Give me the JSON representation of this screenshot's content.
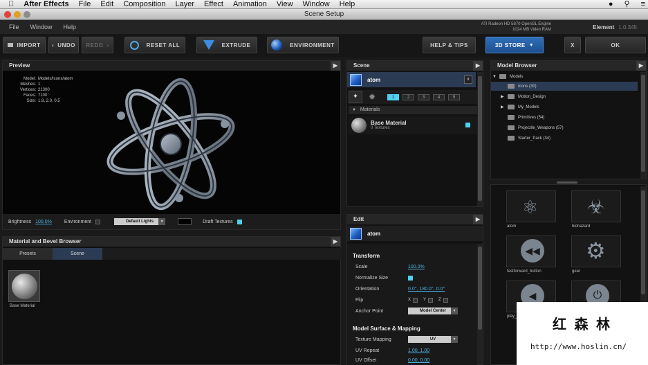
{
  "mac_menu": {
    "app": "After Effects",
    "items": [
      "File",
      "Edit",
      "Composition",
      "Layer",
      "Effect",
      "Animation",
      "View",
      "Window",
      "Help"
    ]
  },
  "window": {
    "title": "Scene Setup"
  },
  "plugin_menu": [
    "File",
    "Window",
    "Help"
  ],
  "gpu_info": {
    "line1": "ATI Radeon HD 5870 OpenGL Engine",
    "line2": "1024 MB Video RAM"
  },
  "version": {
    "label": "Element",
    "number": "1.0.345"
  },
  "toolbar": {
    "import": "IMPORT",
    "undo": "UNDO",
    "redo": "REDO",
    "reset_all": "RESET ALL",
    "extrude": "EXTRUDE",
    "environment": "ENVIRONMENT",
    "help_tips": "HELP & TIPS",
    "store": "3D STORE",
    "close": "X",
    "ok": "OK"
  },
  "preview": {
    "title": "Preview",
    "info": [
      {
        "k": "Model:",
        "v": "Models/Icons/atom"
      },
      {
        "k": "Meshes:",
        "v": "1"
      },
      {
        "k": "Vertices:",
        "v": "21300"
      },
      {
        "k": "Faces:",
        "v": "7100"
      },
      {
        "k": "Size:",
        "v": "1.8, 2.0, 0.5"
      }
    ],
    "brightness_label": "Brightness",
    "brightness_value": "100.0%",
    "environment_label": "Environment",
    "lights_value": "Default Lights",
    "draft_label": "Draft Textures"
  },
  "material_browser": {
    "title": "Material and Bevel Browser",
    "tabs": [
      "Presets",
      "Scene"
    ],
    "items": [
      "Base Material"
    ]
  },
  "scene": {
    "title": "Scene",
    "object": "atom",
    "groups": [
      "1",
      "2",
      "3",
      "4",
      "5"
    ],
    "materials_header": "Materials",
    "material_name": "Base Material",
    "material_sub": "0 Textures"
  },
  "edit": {
    "title": "Edit",
    "object": "atom",
    "transform_header": "Transform",
    "scale_label": "Scale",
    "scale_value": "100.0%",
    "normalize_label": "Normalize Size",
    "orientation_label": "Orientation",
    "orientation_value": "0.0°, 180.0°, 0.0°",
    "flip_label": "Flip",
    "anchor_label": "Anchor Point",
    "anchor_value": "Model Center",
    "surface_header": "Model Surface & Mapping",
    "texture_label": "Texture Mapping",
    "texture_value": "UV",
    "uvrepeat_label": "UV Repeat",
    "uvrepeat_value": "1.00, 1.00",
    "uvoffset_label": "UV Offset",
    "uvoffset_value": "0.00, 0.00"
  },
  "model_browser": {
    "title": "Model Browser",
    "tree": [
      {
        "label": "Models",
        "level": 0,
        "arrow": "▼"
      },
      {
        "label": "Icons (30)",
        "level": 1,
        "arrow": ""
      },
      {
        "label": "Motion_Design",
        "level": 1,
        "arrow": "▶"
      },
      {
        "label": "My_Models",
        "level": 1,
        "arrow": "▶"
      },
      {
        "label": "Primitives (54)",
        "level": 1,
        "arrow": ""
      },
      {
        "label": "Projectile_Weapons (57)",
        "level": 1,
        "arrow": ""
      },
      {
        "label": "Starter_Pack (34)",
        "level": 1,
        "arrow": ""
      }
    ],
    "thumbs": [
      "atom",
      "biohazard",
      "fastforward_button",
      "gear",
      "play_button",
      "power"
    ]
  },
  "watermark": {
    "cn": "红 森 林",
    "url": "http://www.hoslin.cn/"
  },
  "colors": {
    "accent": "#4fd0f0",
    "selection": "#2b3b54",
    "store_blue": "#2f6fb8"
  }
}
